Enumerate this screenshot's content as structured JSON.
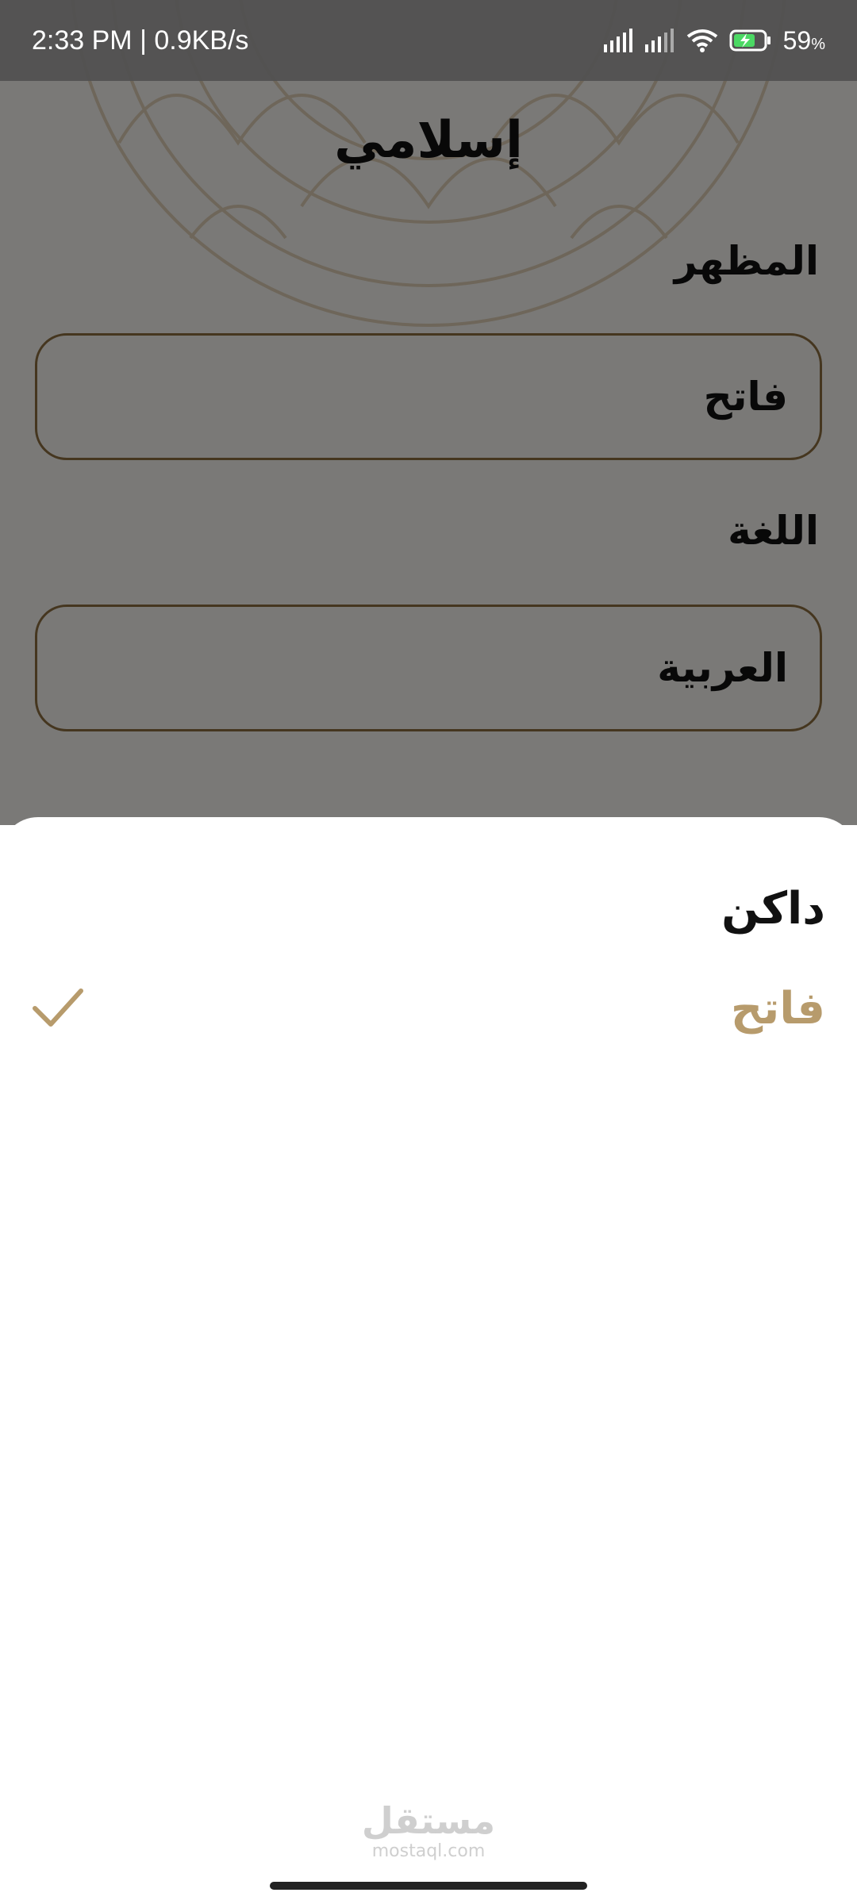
{
  "status_bar": {
    "time_speed": "2:33 PM | 0.9KB/s",
    "battery_percent": "59",
    "battery_unit": "%",
    "icons": [
      "signal-icon",
      "signal-icon",
      "wifi-icon",
      "battery-charging-icon"
    ]
  },
  "header": {
    "title": "إسلامي"
  },
  "settings": {
    "appearance_label": "المظهر",
    "appearance_value": "فاتح",
    "language_label": "اللغة",
    "language_value": "العربية"
  },
  "sheet": {
    "options": [
      {
        "label": "داكن",
        "selected": false
      },
      {
        "label": "فاتح",
        "selected": true
      }
    ],
    "check_icon": "check-icon"
  },
  "watermark": {
    "arabic": "مستقل",
    "latin": "mostaql.com"
  },
  "colors": {
    "accent": "#b79b6c",
    "border": "#8a6c3f",
    "battery_green": "#4cd964"
  }
}
